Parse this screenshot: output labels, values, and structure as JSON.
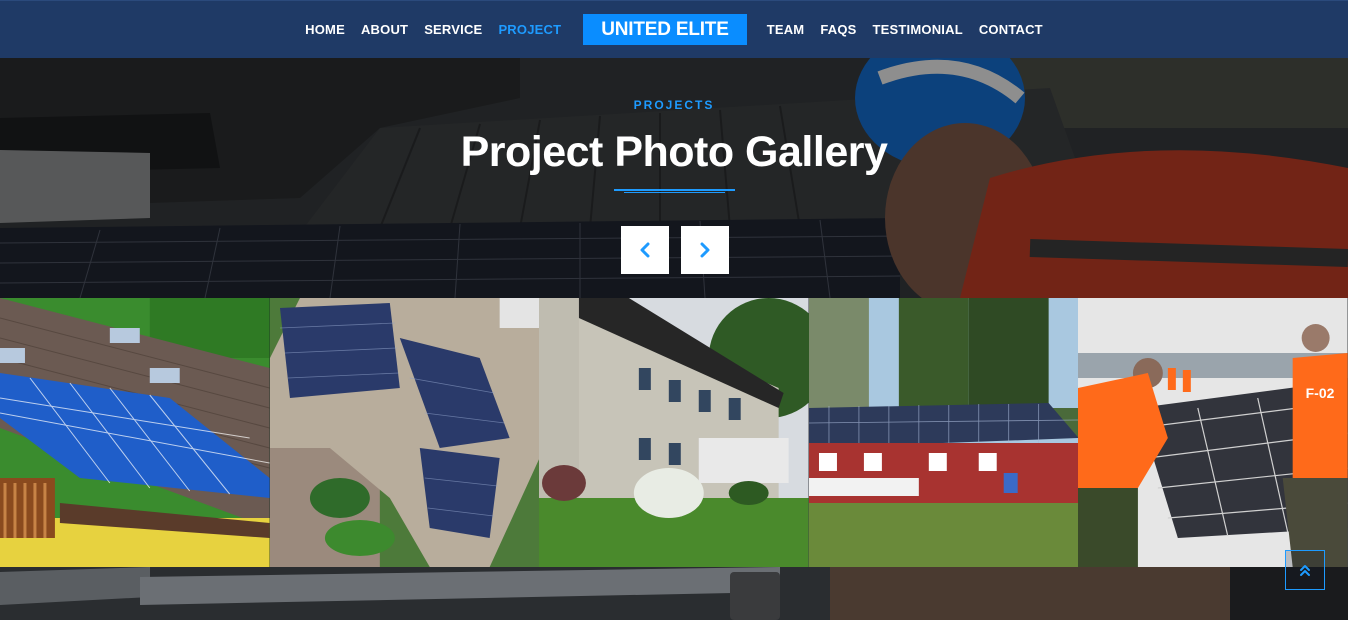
{
  "nav": {
    "left_items": [
      {
        "label": "HOME",
        "active": false
      },
      {
        "label": "ABOUT",
        "active": false
      },
      {
        "label": "SERVICE",
        "active": false
      },
      {
        "label": "PROJECT",
        "active": true
      }
    ],
    "brand": "UNITED ELITE",
    "right_items": [
      {
        "label": "TEAM",
        "active": false
      },
      {
        "label": "FAQS",
        "active": false
      },
      {
        "label": "TESTIMONIAL",
        "active": false
      },
      {
        "label": "CONTACT",
        "active": false
      }
    ]
  },
  "hero": {
    "kicker": "PROJECTS",
    "title": "Project Photo Gallery",
    "prev_icon": "chevron-left-icon",
    "next_icon": "chevron-right-icon"
  },
  "gallery": {
    "photos": [
      {
        "name": "photo-tiled-roof-solar"
      },
      {
        "name": "photo-aerial-apartment-solar"
      },
      {
        "name": "photo-colonial-house-solar"
      },
      {
        "name": "photo-red-cottage-solar"
      },
      {
        "name": "photo-workers-installing-panels"
      }
    ]
  },
  "back_to_top": {
    "icon": "double-chevron-up-icon"
  },
  "colors": {
    "nav_bg": "#1f3a66",
    "accent": "#1e9bff",
    "brand_bg": "#0a8dff"
  }
}
